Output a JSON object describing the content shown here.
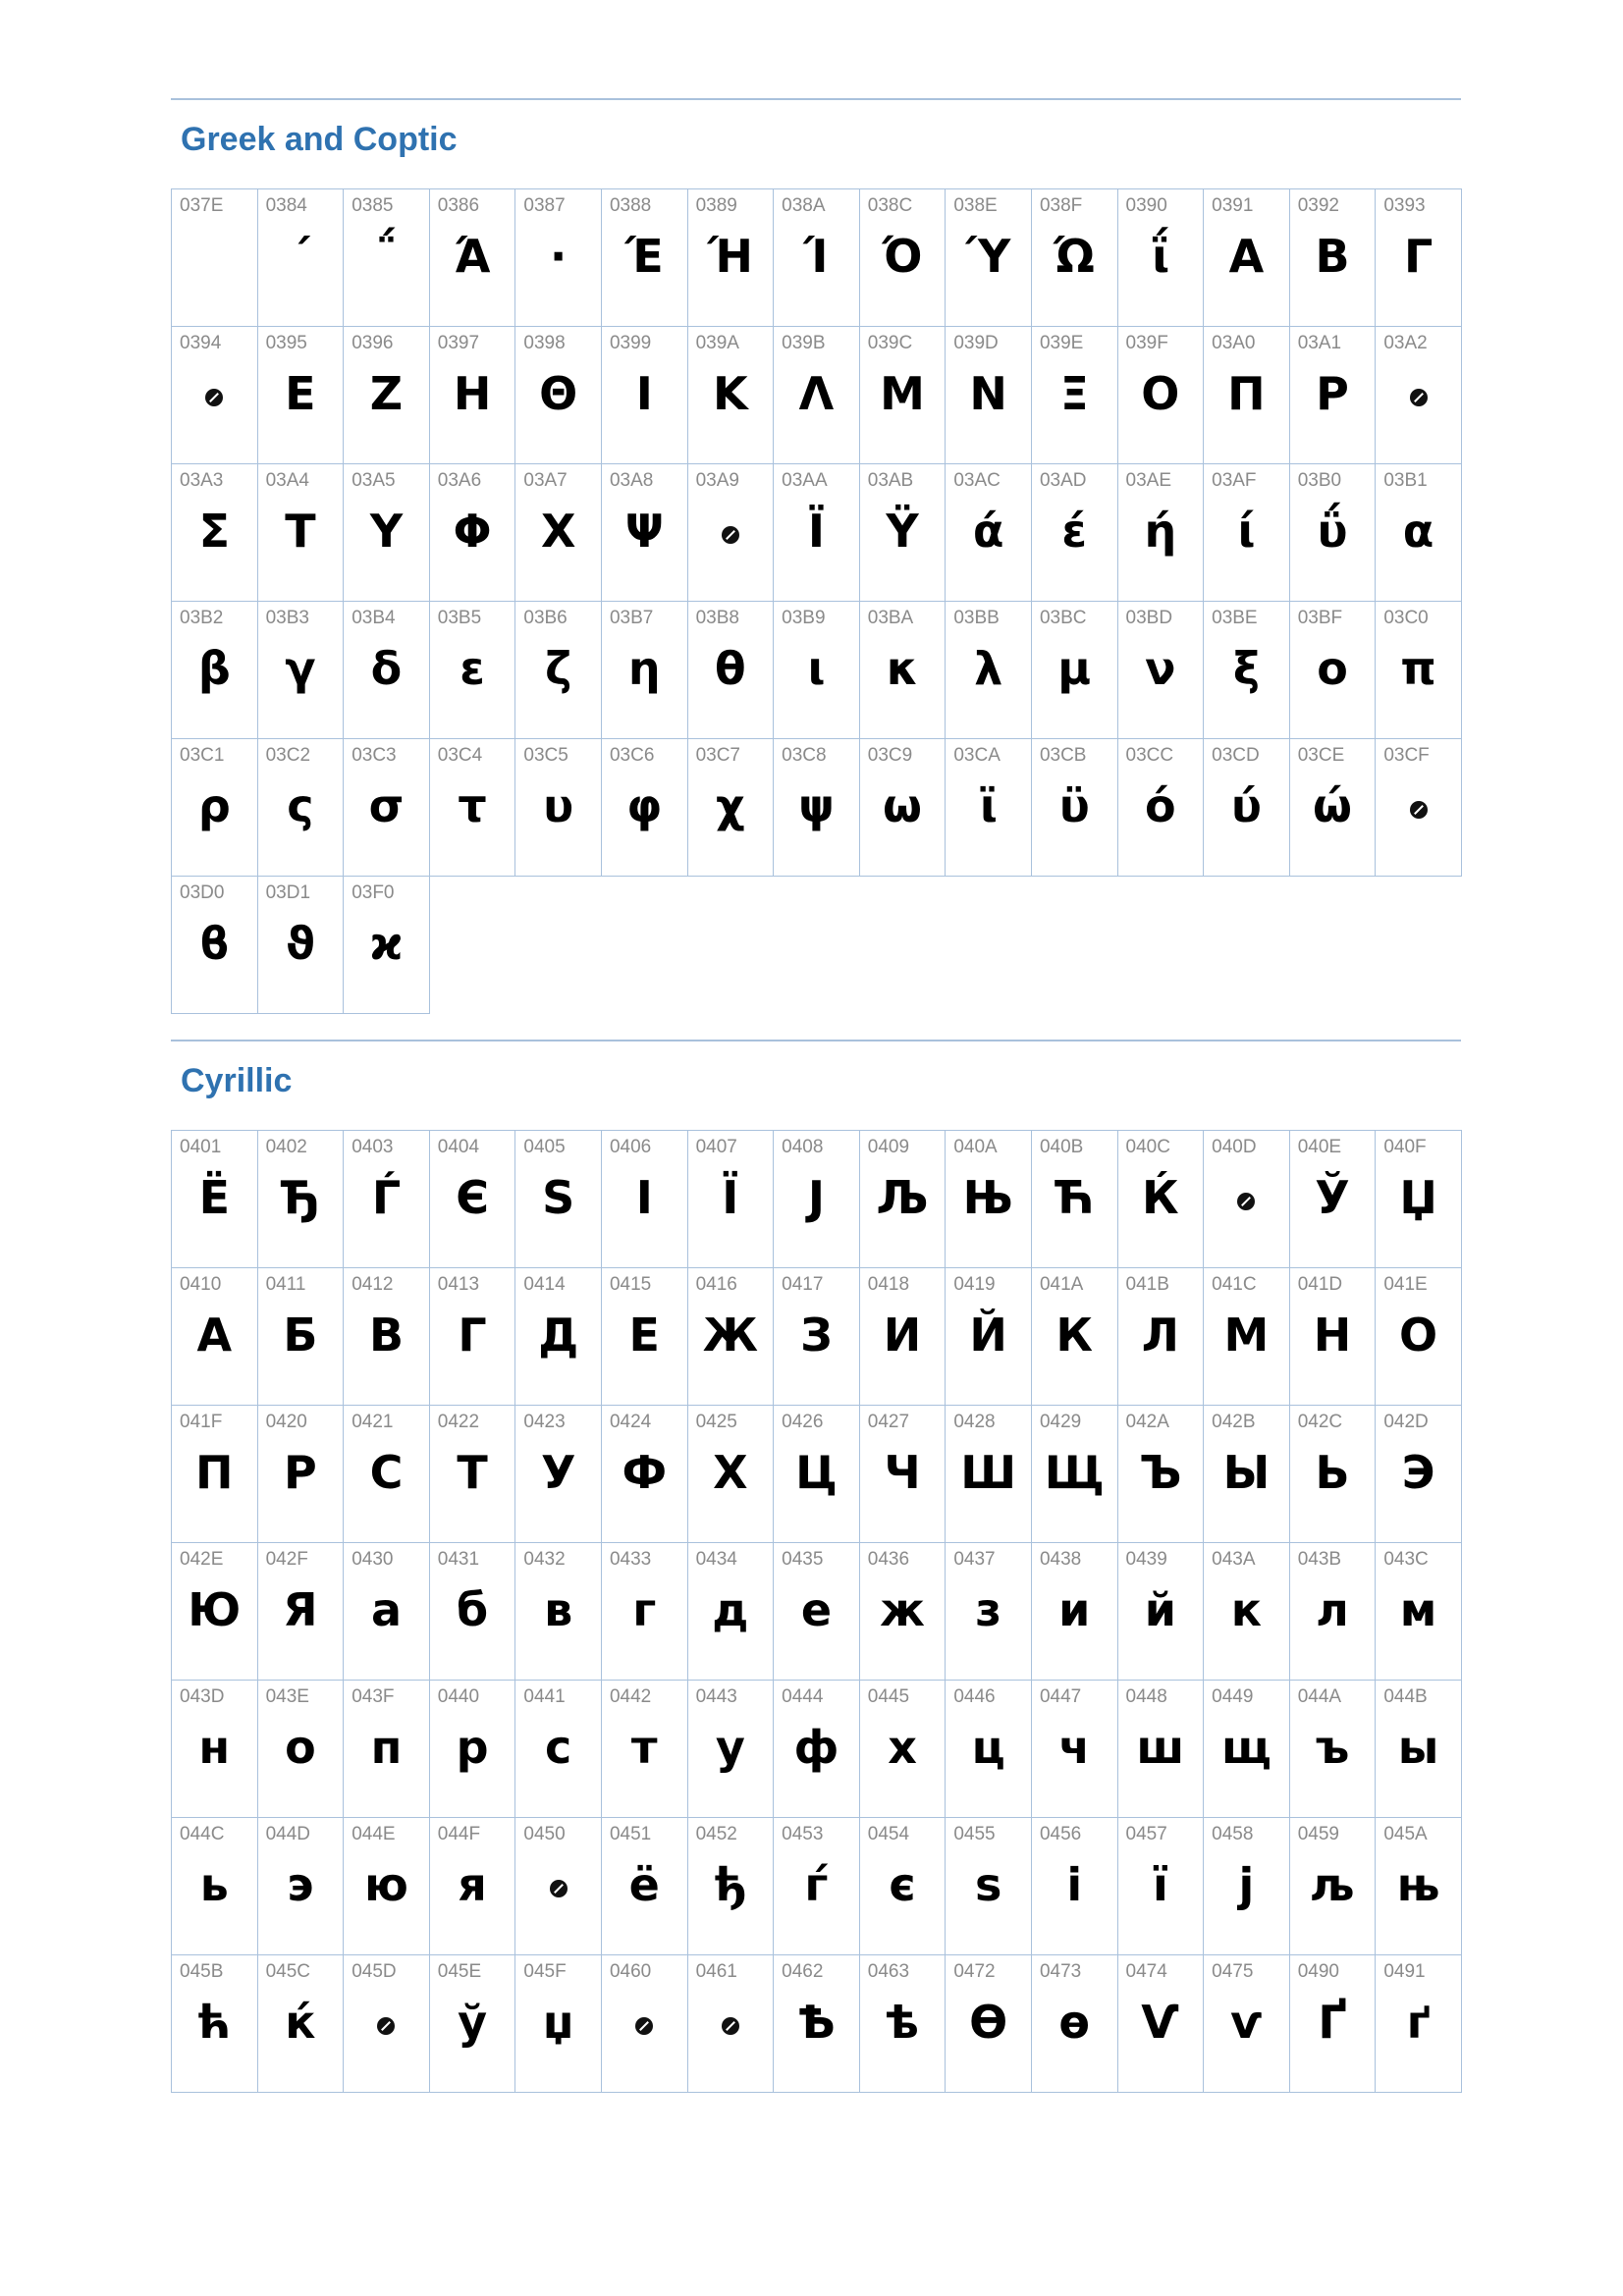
{
  "sections": [
    {
      "title": "Greek and Coptic",
      "cells": [
        {
          "code": "037E",
          "glyph": ""
        },
        {
          "code": "0384",
          "glyph": "΄"
        },
        {
          "code": "0385",
          "glyph": "΅"
        },
        {
          "code": "0386",
          "glyph": "Ά"
        },
        {
          "code": "0387",
          "glyph": "·"
        },
        {
          "code": "0388",
          "glyph": "Έ"
        },
        {
          "code": "0389",
          "glyph": "Ή"
        },
        {
          "code": "038A",
          "glyph": "Ί"
        },
        {
          "code": "038C",
          "glyph": "Ό"
        },
        {
          "code": "038E",
          "glyph": "Ύ"
        },
        {
          "code": "038F",
          "glyph": "Ώ"
        },
        {
          "code": "0390",
          "glyph": "ΐ"
        },
        {
          "code": "0391",
          "glyph": "Α"
        },
        {
          "code": "0392",
          "glyph": "Β"
        },
        {
          "code": "0393",
          "glyph": "Γ"
        },
        {
          "code": "0394",
          "missing": true
        },
        {
          "code": "0395",
          "glyph": "Ε"
        },
        {
          "code": "0396",
          "glyph": "Ζ"
        },
        {
          "code": "0397",
          "glyph": "Η"
        },
        {
          "code": "0398",
          "glyph": "Θ"
        },
        {
          "code": "0399",
          "glyph": "Ι"
        },
        {
          "code": "039A",
          "glyph": "Κ"
        },
        {
          "code": "039B",
          "glyph": "Λ"
        },
        {
          "code": "039C",
          "glyph": "Μ"
        },
        {
          "code": "039D",
          "glyph": "Ν"
        },
        {
          "code": "039E",
          "glyph": "Ξ"
        },
        {
          "code": "039F",
          "glyph": "Ο"
        },
        {
          "code": "03A0",
          "glyph": "Π"
        },
        {
          "code": "03A1",
          "glyph": "Ρ"
        },
        {
          "code": "03A2",
          "missing": true
        },
        {
          "code": "03A3",
          "glyph": "Σ"
        },
        {
          "code": "03A4",
          "glyph": "Τ"
        },
        {
          "code": "03A5",
          "glyph": "Υ"
        },
        {
          "code": "03A6",
          "glyph": "Φ"
        },
        {
          "code": "03A7",
          "glyph": "Χ"
        },
        {
          "code": "03A8",
          "glyph": "Ψ"
        },
        {
          "code": "03A9",
          "missing": true
        },
        {
          "code": "03AA",
          "glyph": "Ϊ"
        },
        {
          "code": "03AB",
          "glyph": "Ϋ"
        },
        {
          "code": "03AC",
          "glyph": "ά"
        },
        {
          "code": "03AD",
          "glyph": "έ"
        },
        {
          "code": "03AE",
          "glyph": "ή"
        },
        {
          "code": "03AF",
          "glyph": "ί"
        },
        {
          "code": "03B0",
          "glyph": "ΰ"
        },
        {
          "code": "03B1",
          "glyph": "α"
        },
        {
          "code": "03B2",
          "glyph": "β"
        },
        {
          "code": "03B3",
          "glyph": "γ"
        },
        {
          "code": "03B4",
          "glyph": "δ"
        },
        {
          "code": "03B5",
          "glyph": "ε"
        },
        {
          "code": "03B6",
          "glyph": "ζ"
        },
        {
          "code": "03B7",
          "glyph": "η"
        },
        {
          "code": "03B8",
          "glyph": "θ"
        },
        {
          "code": "03B9",
          "glyph": "ι"
        },
        {
          "code": "03BA",
          "glyph": "κ"
        },
        {
          "code": "03BB",
          "glyph": "λ"
        },
        {
          "code": "03BC",
          "glyph": "μ"
        },
        {
          "code": "03BD",
          "glyph": "ν"
        },
        {
          "code": "03BE",
          "glyph": "ξ"
        },
        {
          "code": "03BF",
          "glyph": "ο"
        },
        {
          "code": "03C0",
          "glyph": "π"
        },
        {
          "code": "03C1",
          "glyph": "ρ"
        },
        {
          "code": "03C2",
          "glyph": "ς"
        },
        {
          "code": "03C3",
          "glyph": "σ"
        },
        {
          "code": "03C4",
          "glyph": "τ"
        },
        {
          "code": "03C5",
          "glyph": "υ"
        },
        {
          "code": "03C6",
          "glyph": "φ"
        },
        {
          "code": "03C7",
          "glyph": "χ"
        },
        {
          "code": "03C8",
          "glyph": "ψ"
        },
        {
          "code": "03C9",
          "glyph": "ω"
        },
        {
          "code": "03CA",
          "glyph": "ϊ"
        },
        {
          "code": "03CB",
          "glyph": "ϋ"
        },
        {
          "code": "03CC",
          "glyph": "ό"
        },
        {
          "code": "03CD",
          "glyph": "ύ"
        },
        {
          "code": "03CE",
          "glyph": "ώ"
        },
        {
          "code": "03CF",
          "missing": true
        },
        {
          "code": "03D0",
          "glyph": "ϐ"
        },
        {
          "code": "03D1",
          "glyph": "ϑ"
        },
        {
          "code": "03F0",
          "glyph": "ϰ"
        }
      ]
    },
    {
      "title": "Cyrillic",
      "cells": [
        {
          "code": "0401",
          "glyph": "Ё"
        },
        {
          "code": "0402",
          "glyph": "Ђ"
        },
        {
          "code": "0403",
          "glyph": "Ѓ"
        },
        {
          "code": "0404",
          "glyph": "Є"
        },
        {
          "code": "0405",
          "glyph": "Ѕ"
        },
        {
          "code": "0406",
          "glyph": "І"
        },
        {
          "code": "0407",
          "glyph": "Ї"
        },
        {
          "code": "0408",
          "glyph": "Ј"
        },
        {
          "code": "0409",
          "glyph": "Љ"
        },
        {
          "code": "040A",
          "glyph": "Њ"
        },
        {
          "code": "040B",
          "glyph": "Ћ"
        },
        {
          "code": "040C",
          "glyph": "Ќ"
        },
        {
          "code": "040D",
          "missing": true
        },
        {
          "code": "040E",
          "glyph": "Ў"
        },
        {
          "code": "040F",
          "glyph": "Џ"
        },
        {
          "code": "0410",
          "glyph": "А"
        },
        {
          "code": "0411",
          "glyph": "Б"
        },
        {
          "code": "0412",
          "glyph": "В"
        },
        {
          "code": "0413",
          "glyph": "Г"
        },
        {
          "code": "0414",
          "glyph": "Д"
        },
        {
          "code": "0415",
          "glyph": "Е"
        },
        {
          "code": "0416",
          "glyph": "Ж"
        },
        {
          "code": "0417",
          "glyph": "З"
        },
        {
          "code": "0418",
          "glyph": "И"
        },
        {
          "code": "0419",
          "glyph": "Й"
        },
        {
          "code": "041A",
          "glyph": "К"
        },
        {
          "code": "041B",
          "glyph": "Л"
        },
        {
          "code": "041C",
          "glyph": "М"
        },
        {
          "code": "041D",
          "glyph": "Н"
        },
        {
          "code": "041E",
          "glyph": "О"
        },
        {
          "code": "041F",
          "glyph": "П"
        },
        {
          "code": "0420",
          "glyph": "Р"
        },
        {
          "code": "0421",
          "glyph": "С"
        },
        {
          "code": "0422",
          "glyph": "Т"
        },
        {
          "code": "0423",
          "glyph": "У"
        },
        {
          "code": "0424",
          "glyph": "Ф"
        },
        {
          "code": "0425",
          "glyph": "Х"
        },
        {
          "code": "0426",
          "glyph": "Ц"
        },
        {
          "code": "0427",
          "glyph": "Ч"
        },
        {
          "code": "0428",
          "glyph": "Ш"
        },
        {
          "code": "0429",
          "glyph": "Щ"
        },
        {
          "code": "042A",
          "glyph": "Ъ"
        },
        {
          "code": "042B",
          "glyph": "Ы"
        },
        {
          "code": "042C",
          "glyph": "Ь"
        },
        {
          "code": "042D",
          "glyph": "Э"
        },
        {
          "code": "042E",
          "glyph": "Ю"
        },
        {
          "code": "042F",
          "glyph": "Я"
        },
        {
          "code": "0430",
          "glyph": "а"
        },
        {
          "code": "0431",
          "glyph": "б"
        },
        {
          "code": "0432",
          "glyph": "в"
        },
        {
          "code": "0433",
          "glyph": "г"
        },
        {
          "code": "0434",
          "glyph": "д"
        },
        {
          "code": "0435",
          "glyph": "е"
        },
        {
          "code": "0436",
          "glyph": "ж"
        },
        {
          "code": "0437",
          "glyph": "з"
        },
        {
          "code": "0438",
          "glyph": "и"
        },
        {
          "code": "0439",
          "glyph": "й"
        },
        {
          "code": "043A",
          "glyph": "к"
        },
        {
          "code": "043B",
          "glyph": "л"
        },
        {
          "code": "043C",
          "glyph": "м"
        },
        {
          "code": "043D",
          "glyph": "н"
        },
        {
          "code": "043E",
          "glyph": "о"
        },
        {
          "code": "043F",
          "glyph": "п"
        },
        {
          "code": "0440",
          "glyph": "р"
        },
        {
          "code": "0441",
          "glyph": "с"
        },
        {
          "code": "0442",
          "glyph": "т"
        },
        {
          "code": "0443",
          "glyph": "у"
        },
        {
          "code": "0444",
          "glyph": "ф"
        },
        {
          "code": "0445",
          "glyph": "х"
        },
        {
          "code": "0446",
          "glyph": "ц"
        },
        {
          "code": "0447",
          "glyph": "ч"
        },
        {
          "code": "0448",
          "glyph": "ш"
        },
        {
          "code": "0449",
          "glyph": "щ"
        },
        {
          "code": "044A",
          "glyph": "ъ"
        },
        {
          "code": "044B",
          "glyph": "ы"
        },
        {
          "code": "044C",
          "glyph": "ь"
        },
        {
          "code": "044D",
          "glyph": "э"
        },
        {
          "code": "044E",
          "glyph": "ю"
        },
        {
          "code": "044F",
          "glyph": "я"
        },
        {
          "code": "0450",
          "missing": true
        },
        {
          "code": "0451",
          "glyph": "ё"
        },
        {
          "code": "0452",
          "glyph": "ђ"
        },
        {
          "code": "0453",
          "glyph": "ѓ"
        },
        {
          "code": "0454",
          "glyph": "є"
        },
        {
          "code": "0455",
          "glyph": "ѕ"
        },
        {
          "code": "0456",
          "glyph": "і"
        },
        {
          "code": "0457",
          "glyph": "ї"
        },
        {
          "code": "0458",
          "glyph": "ј"
        },
        {
          "code": "0459",
          "glyph": "љ"
        },
        {
          "code": "045A",
          "glyph": "њ"
        },
        {
          "code": "045B",
          "glyph": "ћ"
        },
        {
          "code": "045C",
          "glyph": "ќ"
        },
        {
          "code": "045D",
          "missing": true
        },
        {
          "code": "045E",
          "glyph": "ў"
        },
        {
          "code": "045F",
          "glyph": "џ"
        },
        {
          "code": "0460",
          "missing": true
        },
        {
          "code": "0461",
          "missing": true
        },
        {
          "code": "0462",
          "glyph": "Ѣ"
        },
        {
          "code": "0463",
          "glyph": "ѣ"
        },
        {
          "code": "0472",
          "glyph": "Ѳ"
        },
        {
          "code": "0473",
          "glyph": "ѳ"
        },
        {
          "code": "0474",
          "glyph": "Ѵ"
        },
        {
          "code": "0475",
          "glyph": "ѵ"
        },
        {
          "code": "0490",
          "glyph": "Ґ"
        },
        {
          "code": "0491",
          "glyph": "ґ"
        }
      ]
    }
  ]
}
